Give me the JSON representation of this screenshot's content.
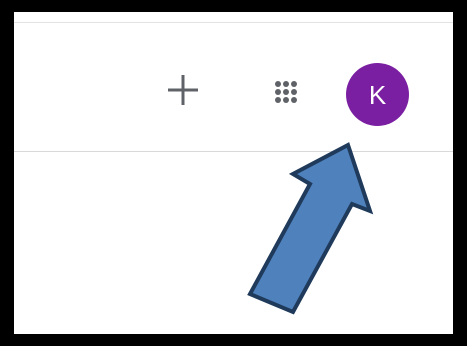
{
  "header": {
    "add_icon": "plus-icon",
    "apps_icon": "apps-grid-icon",
    "avatar_initial": "K",
    "avatar_color": "#7b1fa2"
  },
  "annotation": {
    "arrow_fill": "#4f81bd",
    "arrow_stroke": "#1f3a5a"
  }
}
